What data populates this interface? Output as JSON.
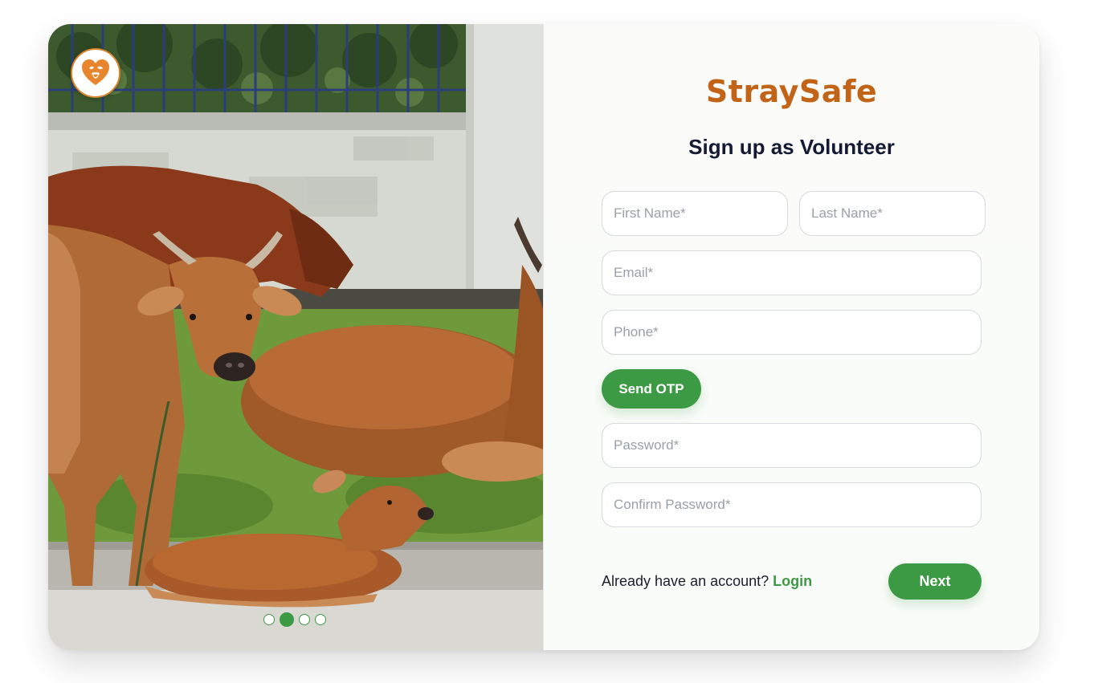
{
  "brand": {
    "name": "StraySafe",
    "accent": "#c26417",
    "logo_icon": "heart-paw-icon"
  },
  "form": {
    "title": "Sign up as Volunteer",
    "first_name_placeholder": "First Name*",
    "last_name_placeholder": "Last Name*",
    "email_placeholder": "Email*",
    "phone_placeholder": "Phone*",
    "send_otp_label": "Send OTP",
    "password_placeholder": "Password*",
    "confirm_password_placeholder": "Confirm Password*",
    "next_label": "Next"
  },
  "footer": {
    "prompt": "Already have an account?",
    "login_label": "Login"
  },
  "carousel": {
    "slide_count": 4,
    "active_index": 1
  },
  "colors": {
    "primary_green": "#3d9a44",
    "title_dark": "#141a33",
    "brand_orange": "#c26417"
  }
}
